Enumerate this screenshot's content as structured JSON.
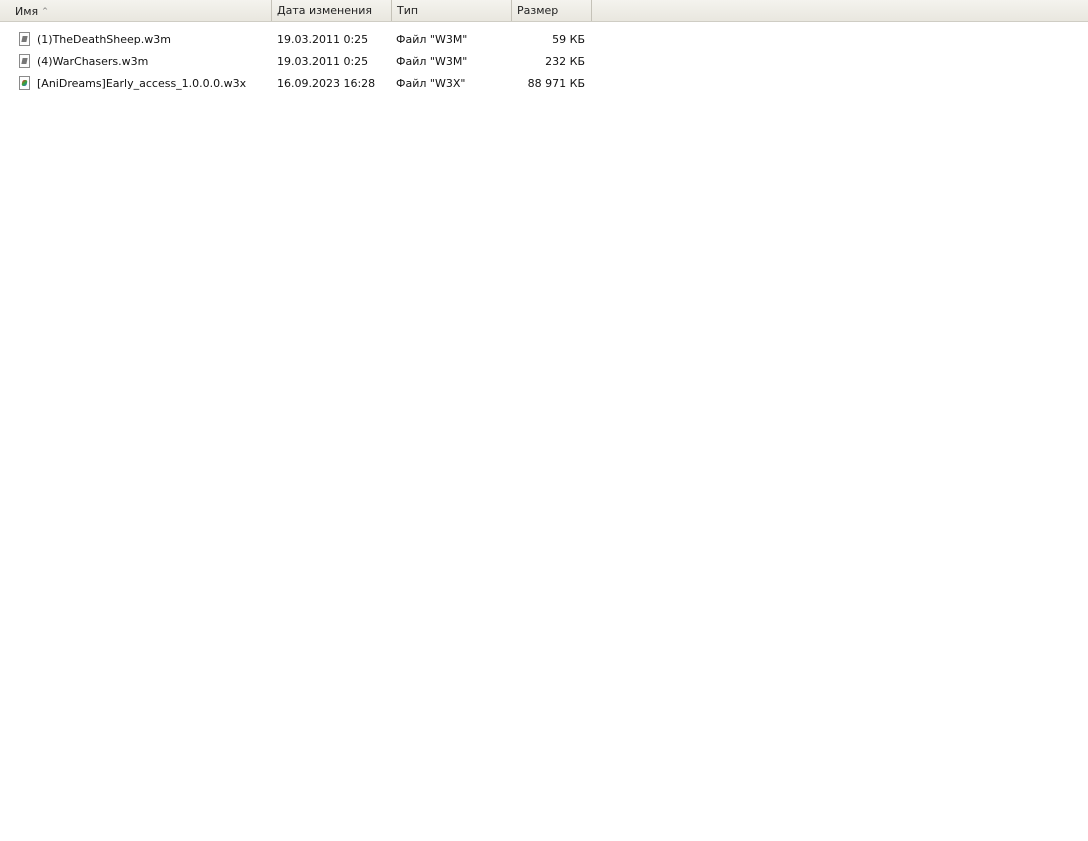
{
  "columns": {
    "name": "Имя",
    "date": "Дата изменения",
    "type": "Тип",
    "size": "Размер"
  },
  "sort": {
    "column": "name",
    "direction": "ascending",
    "indicator": "^"
  },
  "files": [
    {
      "name": "(1)TheDeathSheep.w3m",
      "date": "19.03.2011 0:25",
      "type": "Файл \"W3M\"",
      "size": "59 КБ",
      "icon": "w3m-file-icon"
    },
    {
      "name": "(4)WarChasers.w3m",
      "date": "19.03.2011 0:25",
      "type": "Файл \"W3M\"",
      "size": "232 КБ",
      "icon": "w3m-file-icon"
    },
    {
      "name": "[AniDreams]Early_access_1.0.0.0.w3x",
      "date": "16.09.2023 16:28",
      "type": "Файл \"W3X\"",
      "size": "88 971 КБ",
      "icon": "w3x-file-icon"
    }
  ]
}
